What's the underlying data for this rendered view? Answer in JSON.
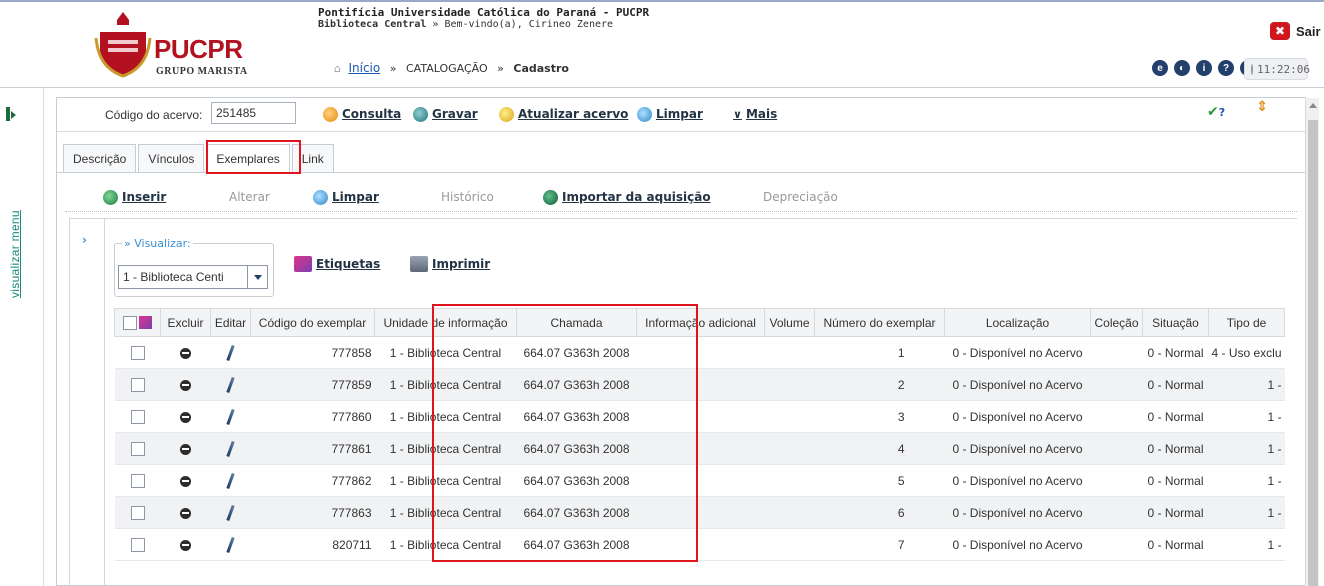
{
  "header": {
    "logo_text": "PUCPR",
    "logo_sub": "GRUPO MARISTA",
    "university": "Pontifícia Universidade Católica do Paraná - PUCPR",
    "library": "Biblioteca Central",
    "welcome": "» Bem-vindo(a), Cirineo Zenere",
    "breadcrumb": {
      "home": "Início",
      "sep1": "»",
      "section": "CATALOGAÇÃO",
      "sep2": "»",
      "current": "Cadastro"
    },
    "sair_x": "✖",
    "sair": "Sair",
    "clock": "11:22:06"
  },
  "sidebar": {
    "vertical_link": "visualizar menu"
  },
  "toolbar": {
    "acervo_label": "Código do acervo:",
    "acervo_value": "251485",
    "consulta": "Consulta",
    "gravar": "Gravar",
    "atualizar": "Atualizar acervo",
    "limpar": "Limpar",
    "mais": "Mais",
    "mais_chevron": "∨",
    "check": "✔",
    "help": "?",
    "updown": "⇕"
  },
  "tabs": [
    "Descrição",
    "Vínculos",
    "Exemplares",
    "Link"
  ],
  "subbar": {
    "inserir": "Inserir",
    "alterar": "Alterar",
    "limpar": "Limpar",
    "historico": "Histórico",
    "importar": "Importar da aquisição",
    "depreciacao": "Depreciação"
  },
  "content": {
    "expand": "›",
    "visualizar_legend": "» Visualizar:",
    "visualizar_value": "1 - Biblioteca Centi",
    "etiquetas": "Etiquetas",
    "imprimir": "Imprimir"
  },
  "table": {
    "columns": [
      "Excluir",
      "Editar",
      "Código do exemplar",
      "Unidade de informação",
      "Chamada",
      "Informação adicional",
      "Volume",
      "Número do exemplar",
      "Localização",
      "Coleção",
      "Situação",
      "Tipo de"
    ],
    "rows": [
      {
        "codigo": "777858",
        "unidade": "1 - Biblioteca Central",
        "chamada": "664.07 G363h 2008",
        "numero": "1",
        "localizacao": "0 - Disponível no Acervo",
        "situacao": "0 - Normal",
        "tipo": "4 - Uso exclu"
      },
      {
        "codigo": "777859",
        "unidade": "1 - Biblioteca Central",
        "chamada": "664.07 G363h 2008",
        "numero": "2",
        "localizacao": "0 - Disponível no Acervo",
        "situacao": "0 - Normal",
        "tipo": "1 -"
      },
      {
        "codigo": "777860",
        "unidade": "1 - Biblioteca Central",
        "chamada": "664.07 G363h 2008",
        "numero": "3",
        "localizacao": "0 - Disponível no Acervo",
        "situacao": "0 - Normal",
        "tipo": "1 -"
      },
      {
        "codigo": "777861",
        "unidade": "1 - Biblioteca Central",
        "chamada": "664.07 G363h 2008",
        "numero": "4",
        "localizacao": "0 - Disponível no Acervo",
        "situacao": "0 - Normal",
        "tipo": "1 -"
      },
      {
        "codigo": "777862",
        "unidade": "1 - Biblioteca Central",
        "chamada": "664.07 G363h 2008",
        "numero": "5",
        "localizacao": "0 - Disponível no Acervo",
        "situacao": "0 - Normal",
        "tipo": "1 -"
      },
      {
        "codigo": "777863",
        "unidade": "1 - Biblioteca Central",
        "chamada": "664.07 G363h 2008",
        "numero": "6",
        "localizacao": "0 - Disponível no Acervo",
        "situacao": "0 - Normal",
        "tipo": "1 -"
      },
      {
        "codigo": "820711",
        "unidade": "1 - Biblioteca Central",
        "chamada": "664.07 G363h 2008",
        "numero": "7",
        "localizacao": "0 - Disponível no Acervo",
        "situacao": "0 - Normal",
        "tipo": "1 -"
      }
    ]
  },
  "colors": {
    "brand_red": "#b3111f",
    "highlight_red": "#e0141e",
    "link_blue": "#1a57b4"
  }
}
